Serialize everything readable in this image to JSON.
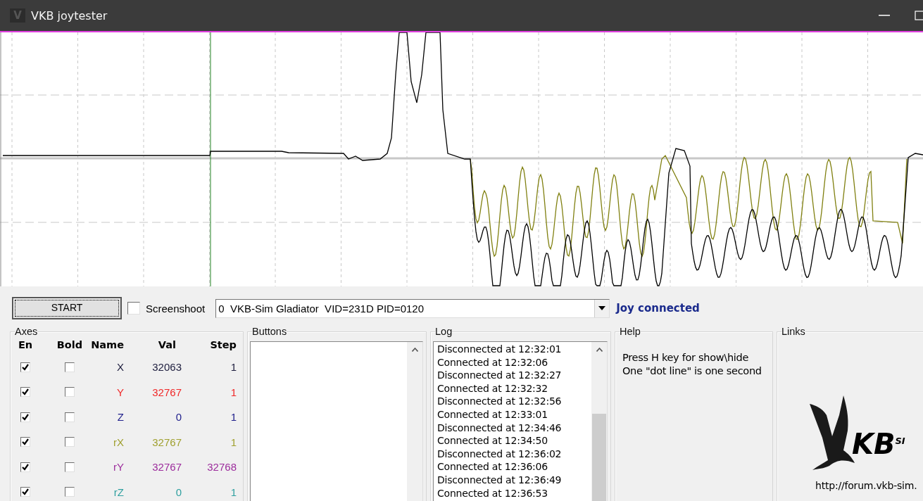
{
  "window": {
    "title": "VKB joytester",
    "app_icon": "V"
  },
  "toolbar": {
    "start_button": "START",
    "screenshot": {
      "label": "Screenshoot",
      "checked": false
    },
    "device": {
      "value": "0  VKB-Sim Gladiator  VID=231D PID=0120"
    },
    "status": "Joy connected"
  },
  "axes": {
    "title": "Axes",
    "columns": [
      "En",
      "Bold",
      "Name",
      "Val",
      "Step"
    ],
    "rows": [
      {
        "enabled": true,
        "bold": false,
        "name": "X",
        "value": "32063",
        "step": "1",
        "color": "#202040"
      },
      {
        "enabled": true,
        "bold": false,
        "name": "Y",
        "value": "32767",
        "step": "1",
        "color": "#f02828"
      },
      {
        "enabled": true,
        "bold": false,
        "name": "Z",
        "value": "0",
        "step": "1",
        "color": "#20208c"
      },
      {
        "enabled": true,
        "bold": false,
        "name": "rX",
        "value": "32767",
        "step": "1",
        "color": "#a0a030"
      },
      {
        "enabled": true,
        "bold": false,
        "name": "rY",
        "value": "32767",
        "step": "32768",
        "color": "#9c2c9c"
      },
      {
        "enabled": true,
        "bold": false,
        "name": "rZ",
        "value": "0",
        "step": "1",
        "color": "#30a0a0"
      }
    ]
  },
  "buttons_panel": {
    "title": "Buttons"
  },
  "log": {
    "title": "Log",
    "entries": [
      "Disconnected at 12:32:01",
      "Connected at 12:32:06",
      "Disconnected at 12:32:27",
      "Connected at 12:32:32",
      "Disconnected at 12:32:56",
      "Connected at 12:33:01",
      "Disconnected at 12:34:46",
      "Connected at 12:34:50",
      "Disconnected at 12:36:02",
      "Connected at 12:36:06",
      "Disconnected at 12:36:49",
      "Connected at 12:36:53"
    ]
  },
  "help": {
    "title": "Help",
    "lines": [
      "Press H key for show\\hide",
      "One \"dot line\" is one second"
    ]
  },
  "links": {
    "title": "Links",
    "logo": "KB$^{SI}$",
    "url": "http://forum.vkb-sim."
  }
}
